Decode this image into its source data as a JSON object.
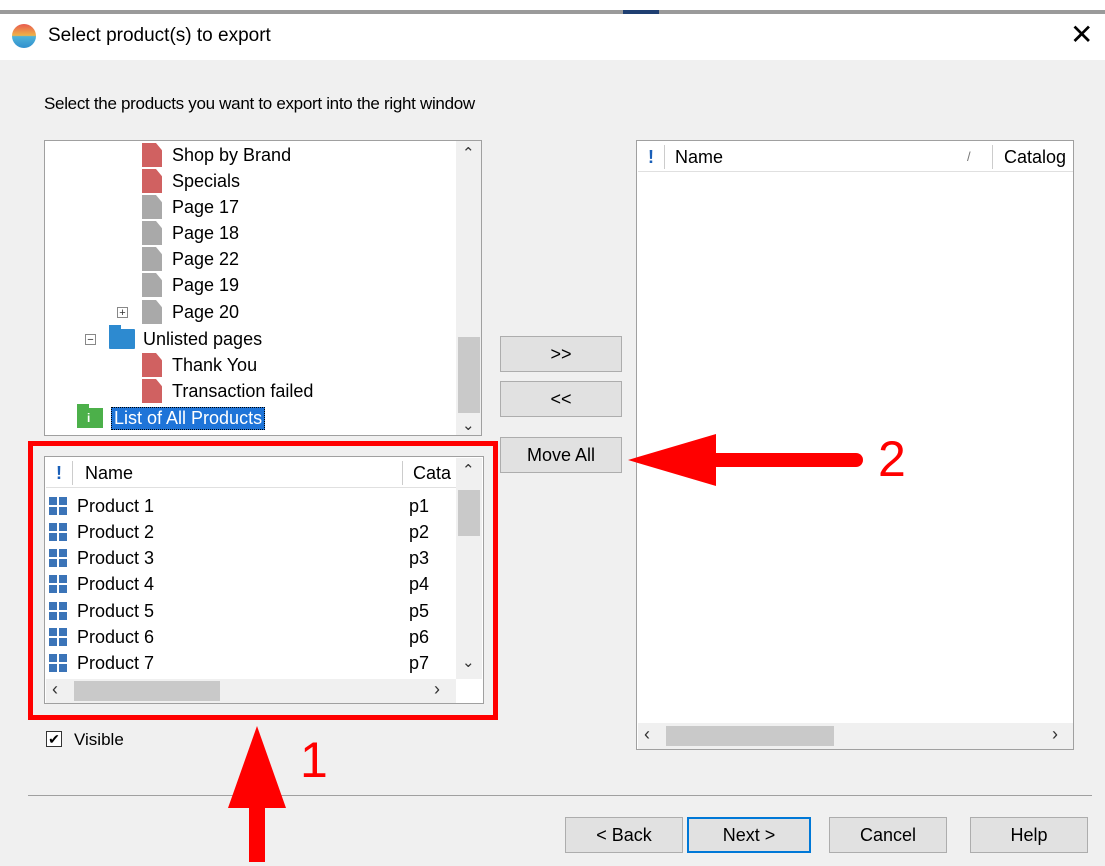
{
  "dialog": {
    "title": "Select product(s) to export",
    "instruction": "Select the products you want to export into the right window"
  },
  "tree": {
    "items": [
      {
        "label": "Shop by Brand",
        "icon": "red-page-icon"
      },
      {
        "label": "Specials",
        "icon": "red-page-icon"
      },
      {
        "label": "Page 17",
        "icon": "gray-page-icon"
      },
      {
        "label": "Page 18",
        "icon": "gray-page-icon"
      },
      {
        "label": "Page 22",
        "icon": "gray-page-icon"
      },
      {
        "label": "Page 19",
        "icon": "gray-page-icon"
      },
      {
        "label": "Page 20",
        "icon": "gray-page-icon",
        "expander": "+"
      },
      {
        "label": "Unlisted pages",
        "icon": "blue-folder-icon",
        "expander": "−"
      },
      {
        "label": "Thank You",
        "icon": "red-page-icon"
      },
      {
        "label": "Transaction failed",
        "icon": "red-page-icon"
      },
      {
        "label": "List of All Products",
        "icon": "green-folder-icon"
      }
    ]
  },
  "product_list": {
    "flag_header": "!",
    "columns": [
      "Name",
      "Cata"
    ],
    "rows": [
      {
        "name": "Product 1",
        "catalog": "p1"
      },
      {
        "name": "Product 2",
        "catalog": "p2"
      },
      {
        "name": "Product 3",
        "catalog": "p3"
      },
      {
        "name": "Product 4",
        "catalog": "p4"
      },
      {
        "name": "Product 5",
        "catalog": "p5"
      },
      {
        "name": "Product 6",
        "catalog": "p6"
      },
      {
        "name": "Product 7",
        "catalog": "p7"
      }
    ]
  },
  "export_list": {
    "flag_header": "!",
    "columns": [
      "Name",
      "Catalog"
    ],
    "sort_indicator": "/"
  },
  "buttons": {
    "add": ">>",
    "remove": "<<",
    "move_all": "Move All",
    "back": "< Back",
    "next": "Next >",
    "cancel": "Cancel",
    "help": "Help"
  },
  "visible_checkbox": {
    "label": "Visible",
    "checked": true,
    "mark": "✔"
  },
  "annotations": {
    "label_1": "1",
    "label_2": "2"
  },
  "colors": {
    "annotation": "#ff0000",
    "selection": "#1e74d8",
    "focus": "#0078d7"
  }
}
